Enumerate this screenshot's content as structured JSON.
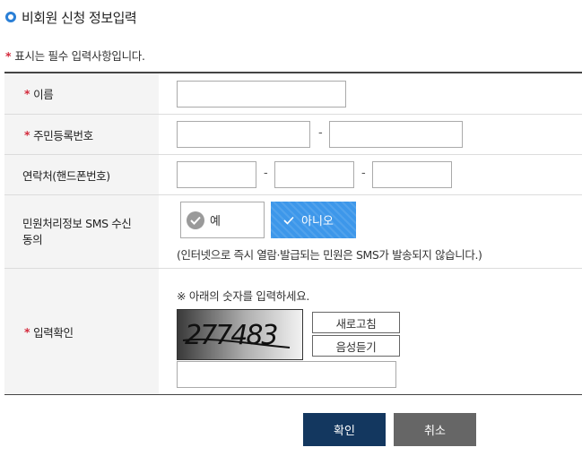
{
  "header": {
    "title": "비회원 신청 정보입력"
  },
  "notice": {
    "marker": "*",
    "text": "표시는 필수 입력사항입니다."
  },
  "fields": {
    "name": {
      "required_mark": "*",
      "label": "이름",
      "value": ""
    },
    "resident_no": {
      "required_mark": "*",
      "label": "주민등록번호",
      "part1": "",
      "part2": "",
      "separator": "-"
    },
    "phone": {
      "label": "연락처(핸드폰번호)",
      "part1": "",
      "part2": "",
      "part3": "",
      "separator": "-"
    },
    "sms": {
      "label": "민원처리정보 SMS 수신 동의",
      "option_yes": "예",
      "option_no": "아니오",
      "selected": "아니오",
      "note": "(인터넷으로 즉시 열람·발급되는 민원은 SMS가 발송되지 않습니다.)"
    },
    "captcha": {
      "required_mark": "*",
      "label": "입력확인",
      "guide": "※ 아래의 숫자를 입력하세요.",
      "image_text": "277483",
      "refresh_label": "새로고침",
      "audio_label": "음성듣기",
      "value": ""
    }
  },
  "buttons": {
    "confirm": "확인",
    "cancel": "취소"
  },
  "colors": {
    "accent": "#2a7fd6",
    "required": "#d42a3c",
    "selected_option": "#3d97ea",
    "confirm_button": "#13375f",
    "cancel_button": "#666666"
  }
}
